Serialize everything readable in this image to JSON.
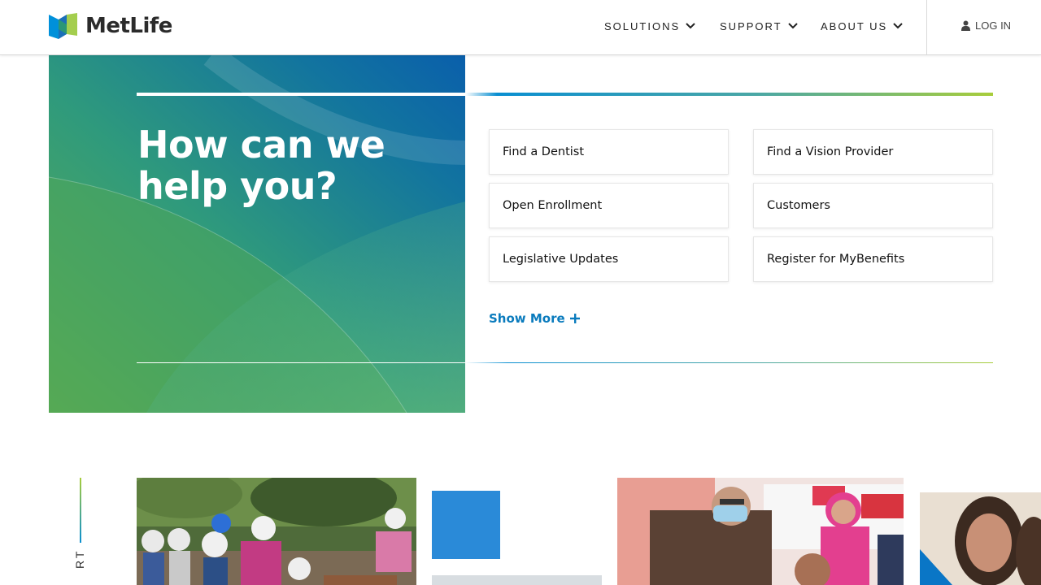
{
  "brand": {
    "name": "MetLife",
    "colors": {
      "blue": "#0a8fd1",
      "green": "#a8cd3b",
      "teal": "#2a9d8f"
    }
  },
  "nav": {
    "items": [
      {
        "label": "SOLUTIONS",
        "icon": "chevron-down-icon"
      },
      {
        "label": "SUPPORT",
        "icon": "chevron-down-icon"
      },
      {
        "label": "ABOUT US",
        "icon": "chevron-down-icon"
      }
    ],
    "login": {
      "label": "LOG IN",
      "icon": "user-icon"
    }
  },
  "hero": {
    "title_line1": "How can we",
    "title_line2": "help you?"
  },
  "quick_links": [
    {
      "label": "Find a Dentist"
    },
    {
      "label": "Find a Vision Provider"
    },
    {
      "label": "Open Enrollment"
    },
    {
      "label": "Customers"
    },
    {
      "label": "Legislative Updates"
    },
    {
      "label": "Register for MyBenefits"
    }
  ],
  "show_more": {
    "label": "Show More",
    "icon": "plus-icon"
  },
  "stories": {
    "side_label": "RT"
  }
}
